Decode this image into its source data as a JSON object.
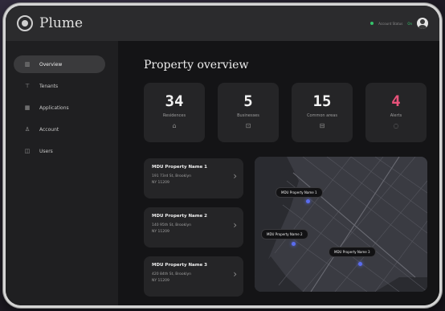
{
  "app": {
    "brand": "Plume"
  },
  "header": {
    "status_text": "Account Status",
    "status_value": "On"
  },
  "sidebar": {
    "items": [
      {
        "label": "Overview",
        "icon": "chart-icon",
        "glyph": "▥",
        "active": true
      },
      {
        "label": "Tenants",
        "icon": "filter-icon",
        "glyph": "⊤",
        "active": false
      },
      {
        "label": "Applications",
        "icon": "grid-icon",
        "glyph": "▦",
        "active": false
      },
      {
        "label": "Account",
        "icon": "person-icon",
        "glyph": "♙",
        "active": false
      },
      {
        "label": "Users",
        "icon": "users-icon",
        "glyph": "◫",
        "active": false
      }
    ]
  },
  "main": {
    "title": "Property overview",
    "stats": [
      {
        "value": "34",
        "label": "Residences",
        "icon": "home-icon",
        "glyph": "⌂"
      },
      {
        "value": "5",
        "label": "Businesses",
        "icon": "briefcase-icon",
        "glyph": "⊡"
      },
      {
        "value": "15",
        "label": "Common areas",
        "icon": "bed-icon",
        "glyph": "⊟"
      },
      {
        "value": "4",
        "label": "Alerts",
        "icon": "bell-icon",
        "glyph": "◌"
      }
    ],
    "properties": [
      {
        "name": "MDU Property Name 1",
        "line1": "191 73rd St, Brooklyn",
        "line2": "NY 11209"
      },
      {
        "name": "MDU Property Name 2",
        "line1": "140 95th St, Brooklyn",
        "line2": "NY 11209"
      },
      {
        "name": "MDU Property Name 3",
        "line1": "420 84th St, Brooklyn",
        "line2": "NY 11209"
      }
    ],
    "map": {
      "pins": [
        {
          "label": "MDU Property Name 1"
        },
        {
          "label": "MDU Property Name 2"
        },
        {
          "label": "MDU Property Name 3"
        }
      ]
    }
  },
  "colors": {
    "alert": "#e8527a",
    "status_on": "#35c46b",
    "pin": "#5a6cf0"
  }
}
